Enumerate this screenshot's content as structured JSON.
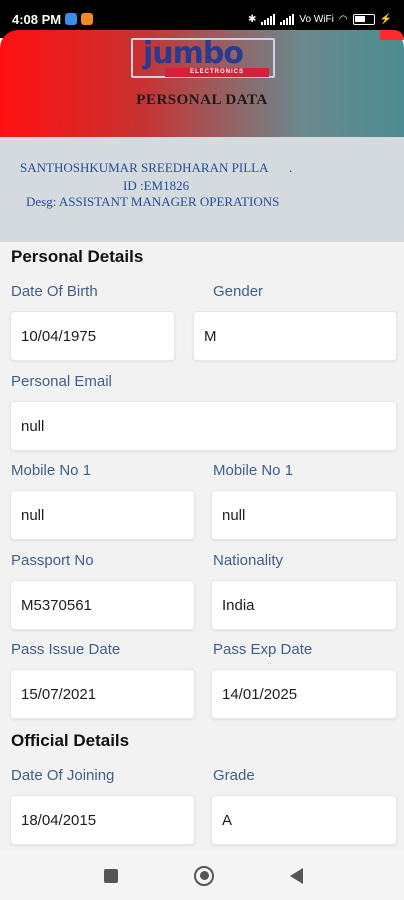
{
  "status_bar": {
    "time": "4:08 PM",
    "network": "Vo WiFi",
    "battery_level": 0.5
  },
  "header": {
    "logo_text": "jumbo",
    "logo_subtext": "ELECTRONICS",
    "title": "PERSONAL DATA"
  },
  "employee": {
    "name": "SANTHOSHKUMAR SREEDHARAN PILLA",
    "name_suffix": ".",
    "id_line": "ID :EM1826",
    "designation_line": "Desg: ASSISTANT MANAGER OPERATIONS"
  },
  "personal_details": {
    "title": "Personal Details",
    "dob_label": "Date Of Birth",
    "dob_value": "10/04/1975",
    "gender_label": "Gender",
    "gender_value": "M",
    "email_label": "Personal Email",
    "email_value": "null",
    "mobile1_label": "Mobile No 1",
    "mobile1_value": "null",
    "mobile2_label": "Mobile No 1",
    "mobile2_value": "null",
    "passport_label": "Passport No",
    "passport_value": "M5370561",
    "nationality_label": "Nationality",
    "nationality_value": "India",
    "pass_issue_label": "Pass Issue Date",
    "pass_issue_value": "15/07/2021",
    "pass_exp_label": "Pass Exp Date",
    "pass_exp_value": "14/01/2025"
  },
  "official_details": {
    "title": "Official Details",
    "doj_label": "Date Of Joining",
    "doj_value": "18/04/2015",
    "grade_label": "Grade",
    "grade_value": "A"
  },
  "colors": {
    "header_start": "#ff1010",
    "header_end": "#4d8c90",
    "label": "#3f5f8a",
    "employee_text": "#224e9c",
    "employee_band": "#d4dadd"
  }
}
